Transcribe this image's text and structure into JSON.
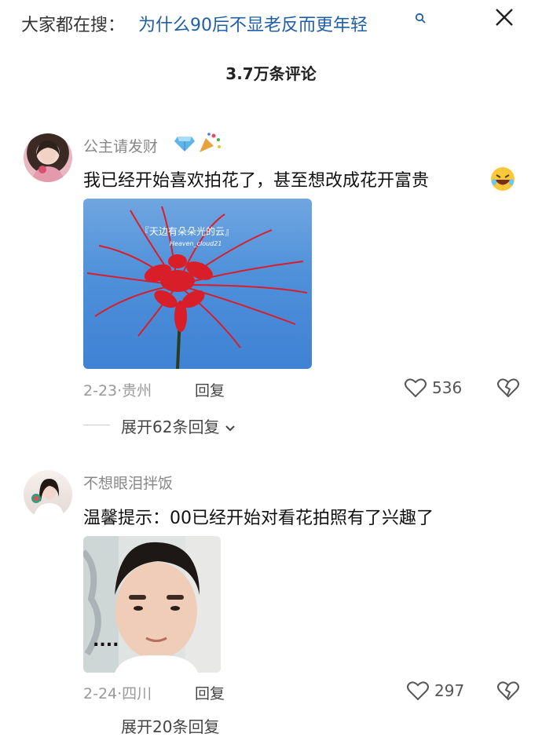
{
  "header": {
    "search_prefix": "大家都在搜：",
    "search_query": "为什么90后不显老反而更年轻",
    "search_icon": "search-icon",
    "close_icon": "close-icon"
  },
  "comment_count": "3.7万条评论",
  "comments": [
    {
      "username": "公主请发财",
      "username_emojis": [
        "diamond",
        "party-popper"
      ],
      "text": "我已经开始喜欢拍花了，甚至想改成花开富贵",
      "text_emoji": "rofl-emoji",
      "image_text": "『天边有朵朵光的云』",
      "image_subtext": "Heaven_cloud21",
      "date": "2-23",
      "location": "贵州",
      "reply_label": "回复",
      "likes": "536",
      "expand_label": "展开62条回复"
    },
    {
      "username": "不想眼泪拌饭",
      "text": "温馨提示：00已经开始对看花拍照有了兴趣了",
      "image_dots": "....",
      "date": "2-24",
      "location": "四川",
      "reply_label": "回复",
      "likes": "297",
      "expand_label": "展开20条回复"
    }
  ]
}
